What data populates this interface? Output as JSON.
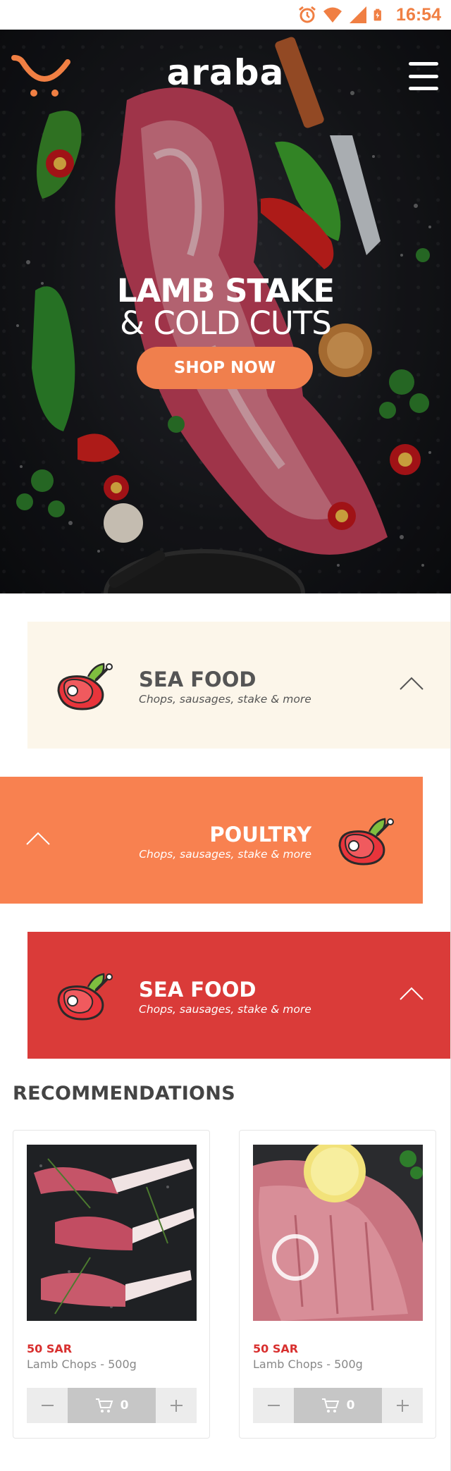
{
  "status_bar": {
    "time": "16:54",
    "icons": [
      "alarm-icon",
      "wifi-icon",
      "cell-signal-icon",
      "battery-charging-icon"
    ],
    "accent": "#f07f43"
  },
  "header": {
    "brand": "araba",
    "logo_icon": "smile-cart-logo-icon",
    "menu_icon": "hamburger-menu-icon"
  },
  "hero": {
    "title_line1": "LAMB STAKE",
    "title_line2": "& COLD CUTS",
    "cta_label": "SHOP NOW",
    "cta_color": "#f07f4d"
  },
  "categories": [
    {
      "name": "SEA FOOD",
      "subtitle": "Chops, sausages, stake & more",
      "icon": "meat-steak-icon",
      "bg": "#fcf6ea",
      "chevron": "chevron-up-icon"
    },
    {
      "name": "POULTRY",
      "subtitle": "Chops, sausages, stake & more",
      "icon": "meat-steak-icon",
      "bg": "#f88150",
      "chevron": "chevron-up-icon"
    },
    {
      "name": "SEA FOOD",
      "subtitle": "Chops, sausages, stake & more",
      "icon": "meat-steak-icon",
      "bg": "#da3b39",
      "chevron": "chevron-up-icon"
    }
  ],
  "recommendations": {
    "title": "RECOMMENDATIONS",
    "products": [
      {
        "price": "50 SAR",
        "name": "Lamb Chops - 500g",
        "quantity": "0",
        "cart_icon": "cart-icon"
      },
      {
        "price": "50 SAR",
        "name": "Lamb Chops - 500g",
        "quantity": "0",
        "cart_icon": "cart-icon"
      }
    ]
  }
}
